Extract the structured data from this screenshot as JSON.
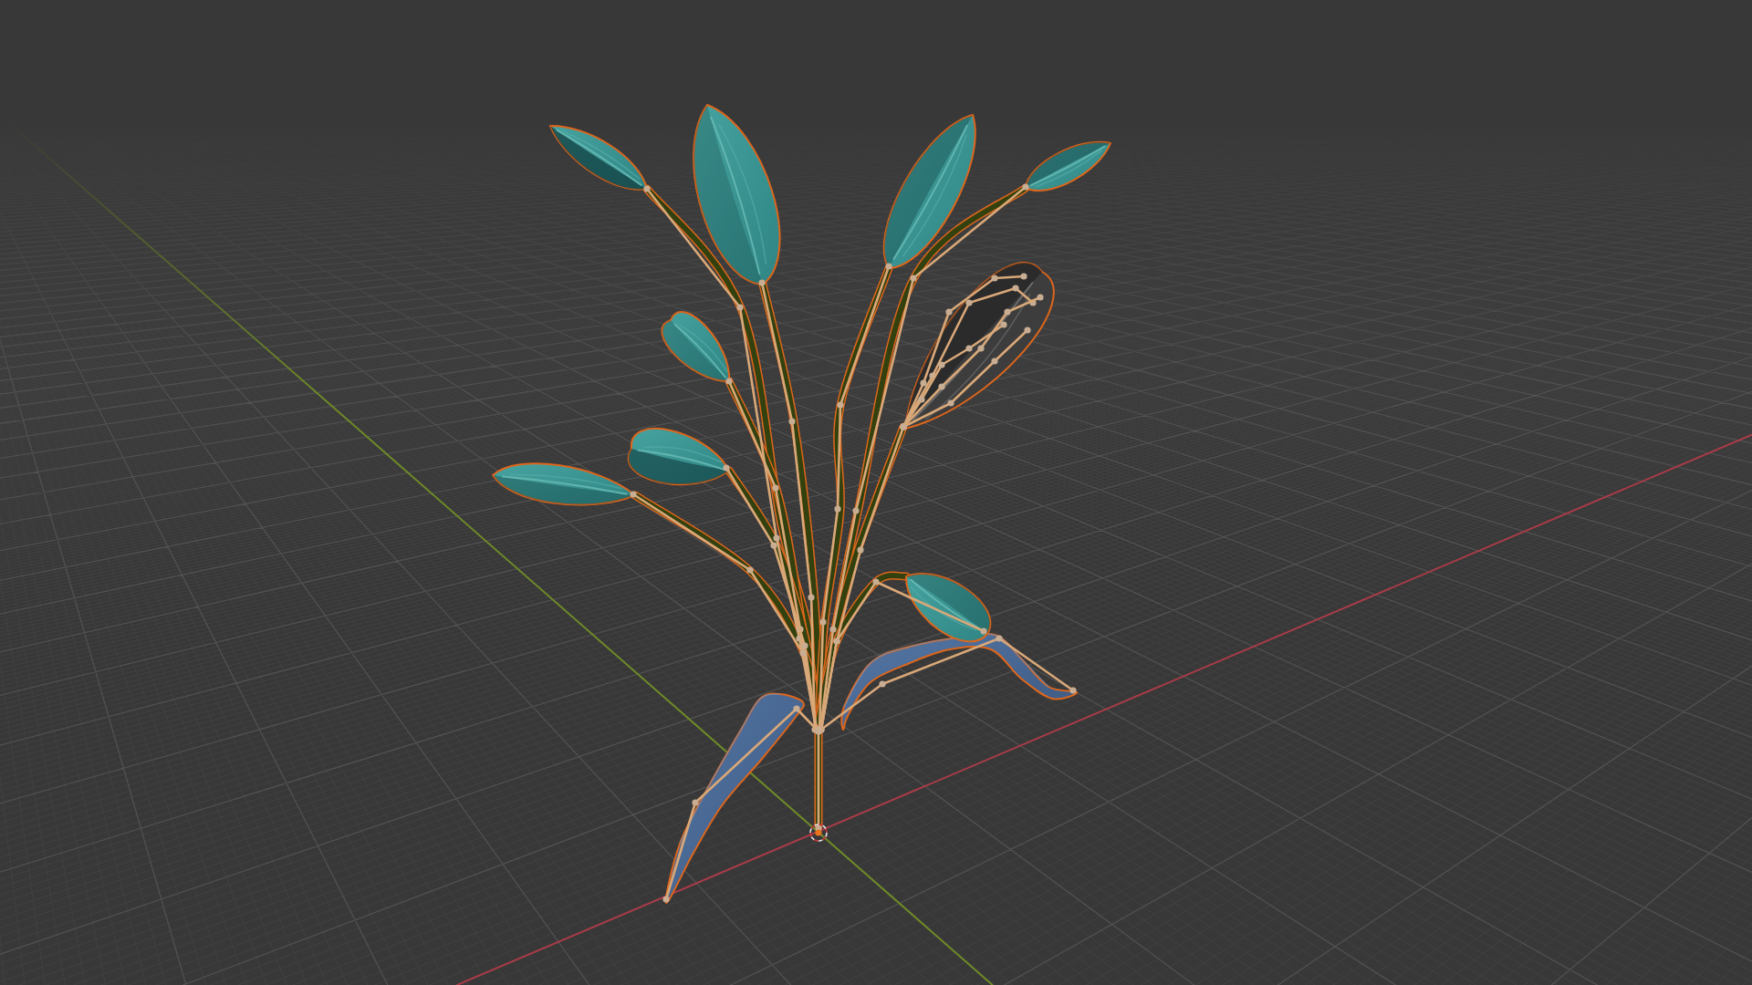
{
  "viewport": {
    "plant": {
      "selected": true
    }
  }
}
